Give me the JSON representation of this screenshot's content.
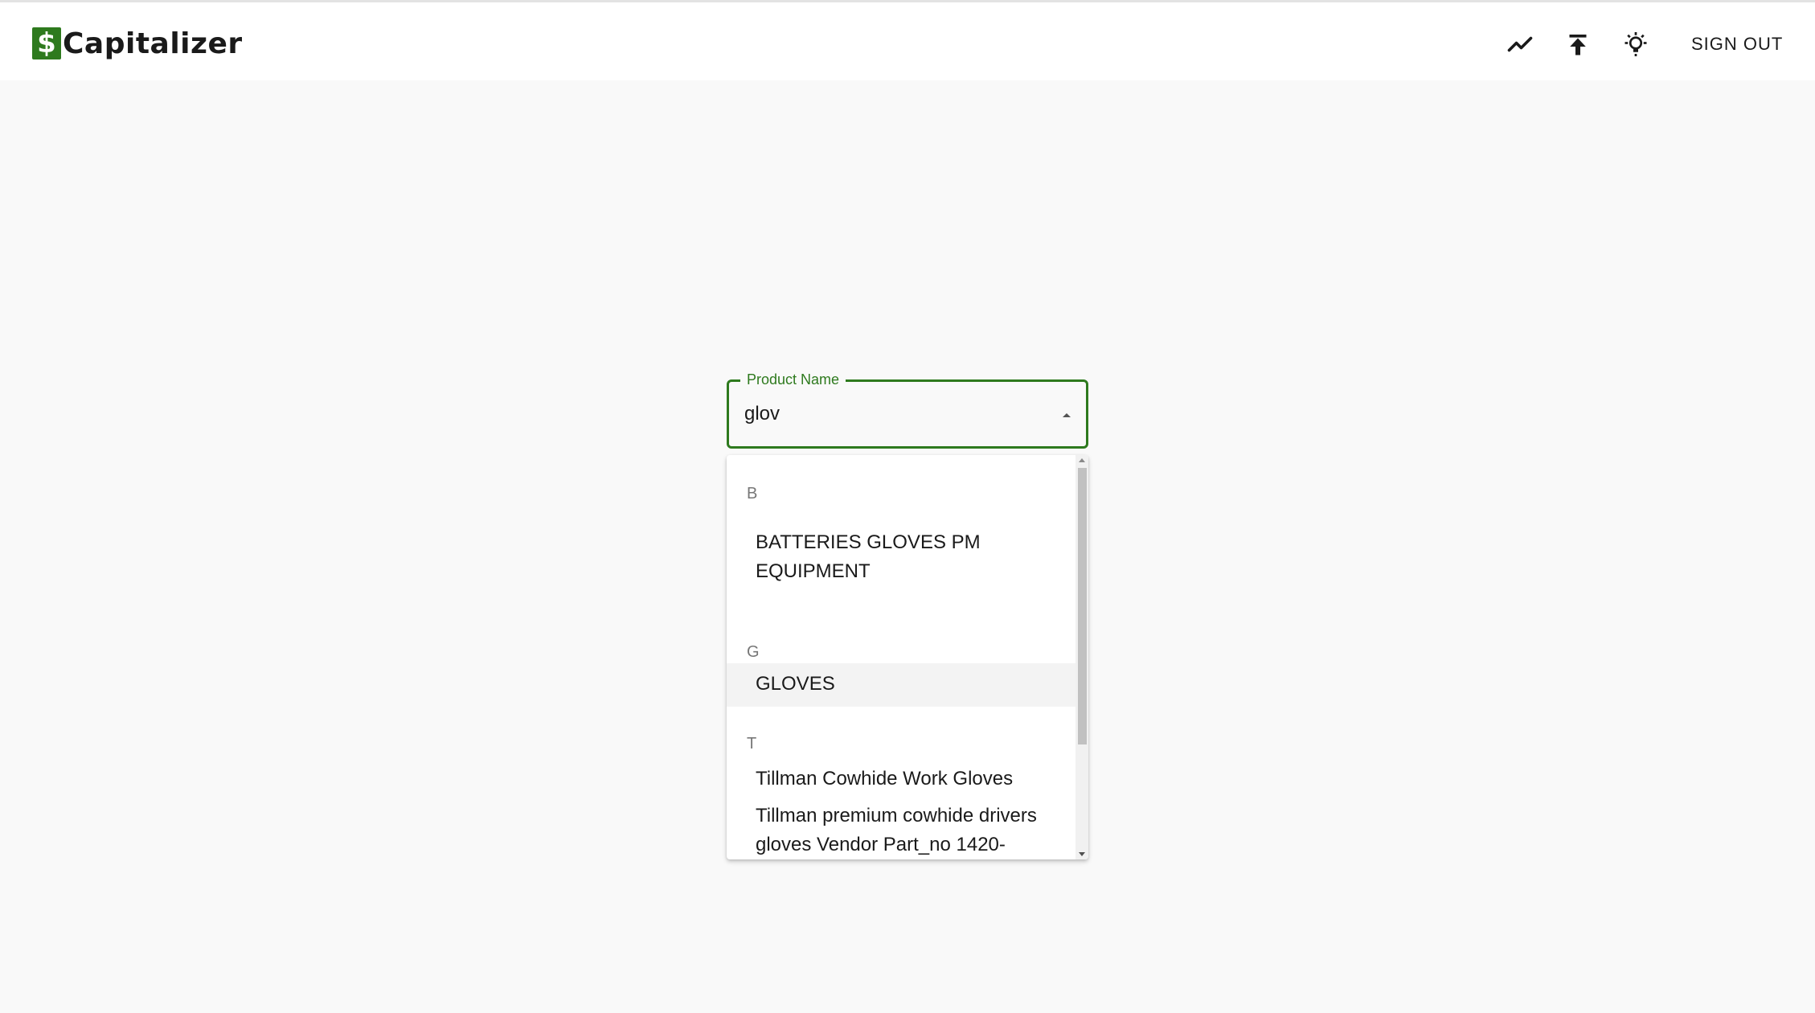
{
  "app": {
    "logo_mark": "$",
    "logo_text": "Capitalizer"
  },
  "header": {
    "icons": [
      "trending-icon",
      "upload-icon",
      "lightbulb-icon"
    ],
    "signout_label": "SIGN OUT"
  },
  "product_field": {
    "label": "Product Name",
    "value": "glov"
  },
  "dropdown": {
    "groups": [
      {
        "header": "B",
        "options": [
          "BATTERIES GLOVES PM EQUIPMENT"
        ]
      },
      {
        "header": "G",
        "options": [
          "GLOVES"
        ]
      },
      {
        "header": "T",
        "options": [
          "Tillman Cowhide Work Gloves",
          "Tillman premium cowhide drivers gloves Vendor Part_no 1420-"
        ]
      }
    ],
    "highlighted_option": "GLOVES"
  },
  "colors": {
    "accent": "#2e7a1e",
    "background": "#f9f9f9",
    "highlight": "#f3f3f3"
  }
}
